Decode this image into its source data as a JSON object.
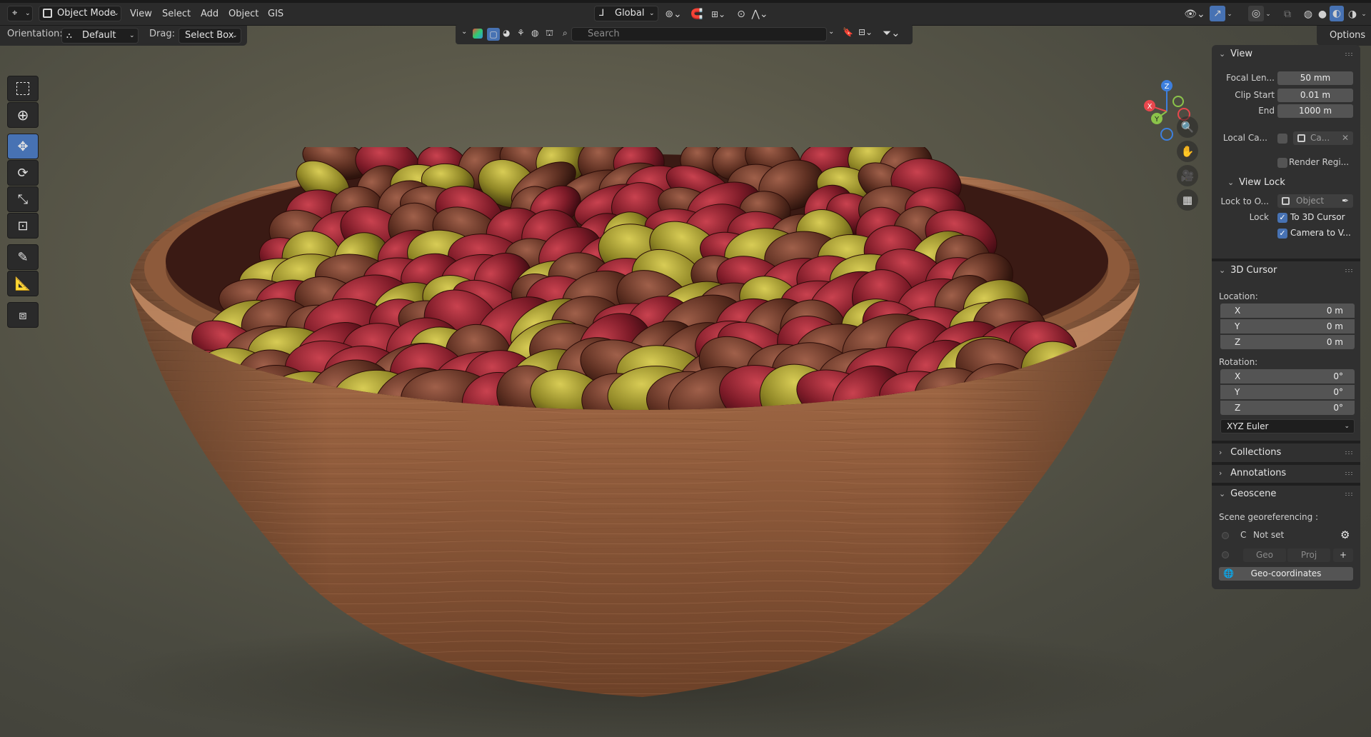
{
  "header": {
    "mode_label": "Object Mode",
    "menus": [
      "View",
      "Select",
      "Add",
      "Object",
      "GIS"
    ],
    "transform_orientation": "Global",
    "options_label": "Options"
  },
  "tool_settings": {
    "orientation_label": "Orientation:",
    "orientation_value": "Default",
    "drag_label": "Drag:",
    "drag_value": "Select Box"
  },
  "viewport_header": {
    "search_placeholder": "Search"
  },
  "gizmo": {
    "x": "X",
    "y": "Y",
    "z": "Z"
  },
  "npanel": {
    "view": {
      "title": "View",
      "focal_length_label": "Focal Len...",
      "focal_length_value": "50 mm",
      "clip_start_label": "Clip Start",
      "clip_start_value": "0.01 m",
      "clip_end_label": "End",
      "clip_end_value": "1000 m",
      "local_camera_label": "Local Ca...",
      "local_camera_value": "Ca...",
      "render_region_label": "Render Regi...",
      "view_lock_title": "View Lock",
      "lock_object_label": "Lock to O...",
      "lock_object_value": "Object",
      "lock_label": "Lock",
      "to_3d_cursor_label": "To 3D Cursor",
      "camera_to_view_label": "Camera to V..."
    },
    "cursor": {
      "title": "3D Cursor",
      "location_label": "Location:",
      "location": [
        {
          "axis": "X",
          "value": "0 m"
        },
        {
          "axis": "Y",
          "value": "0 m"
        },
        {
          "axis": "Z",
          "value": "0 m"
        }
      ],
      "rotation_label": "Rotation:",
      "rotation": [
        {
          "axis": "X",
          "value": "0°"
        },
        {
          "axis": "Y",
          "value": "0°"
        },
        {
          "axis": "Z",
          "value": "0°"
        }
      ],
      "rotation_mode": "XYZ Euler"
    },
    "collections_title": "Collections",
    "annotations_title": "Annotations",
    "geoscene": {
      "title": "Geoscene",
      "georef_label": "Scene georeferencing :",
      "crs_letter": "C",
      "crs_value": "Not set",
      "geo_label": "Geo",
      "proj_label": "Proj",
      "geo_coordinates_label": "Geo-coordinates"
    }
  },
  "colors": {
    "accent": "#4772b3",
    "panel_bg": "#303030",
    "header_bg": "#2b2b2b",
    "field_bg": "#545454",
    "axis_x": "#e8474d",
    "axis_y": "#8bc34a",
    "axis_z": "#3d7fde"
  }
}
